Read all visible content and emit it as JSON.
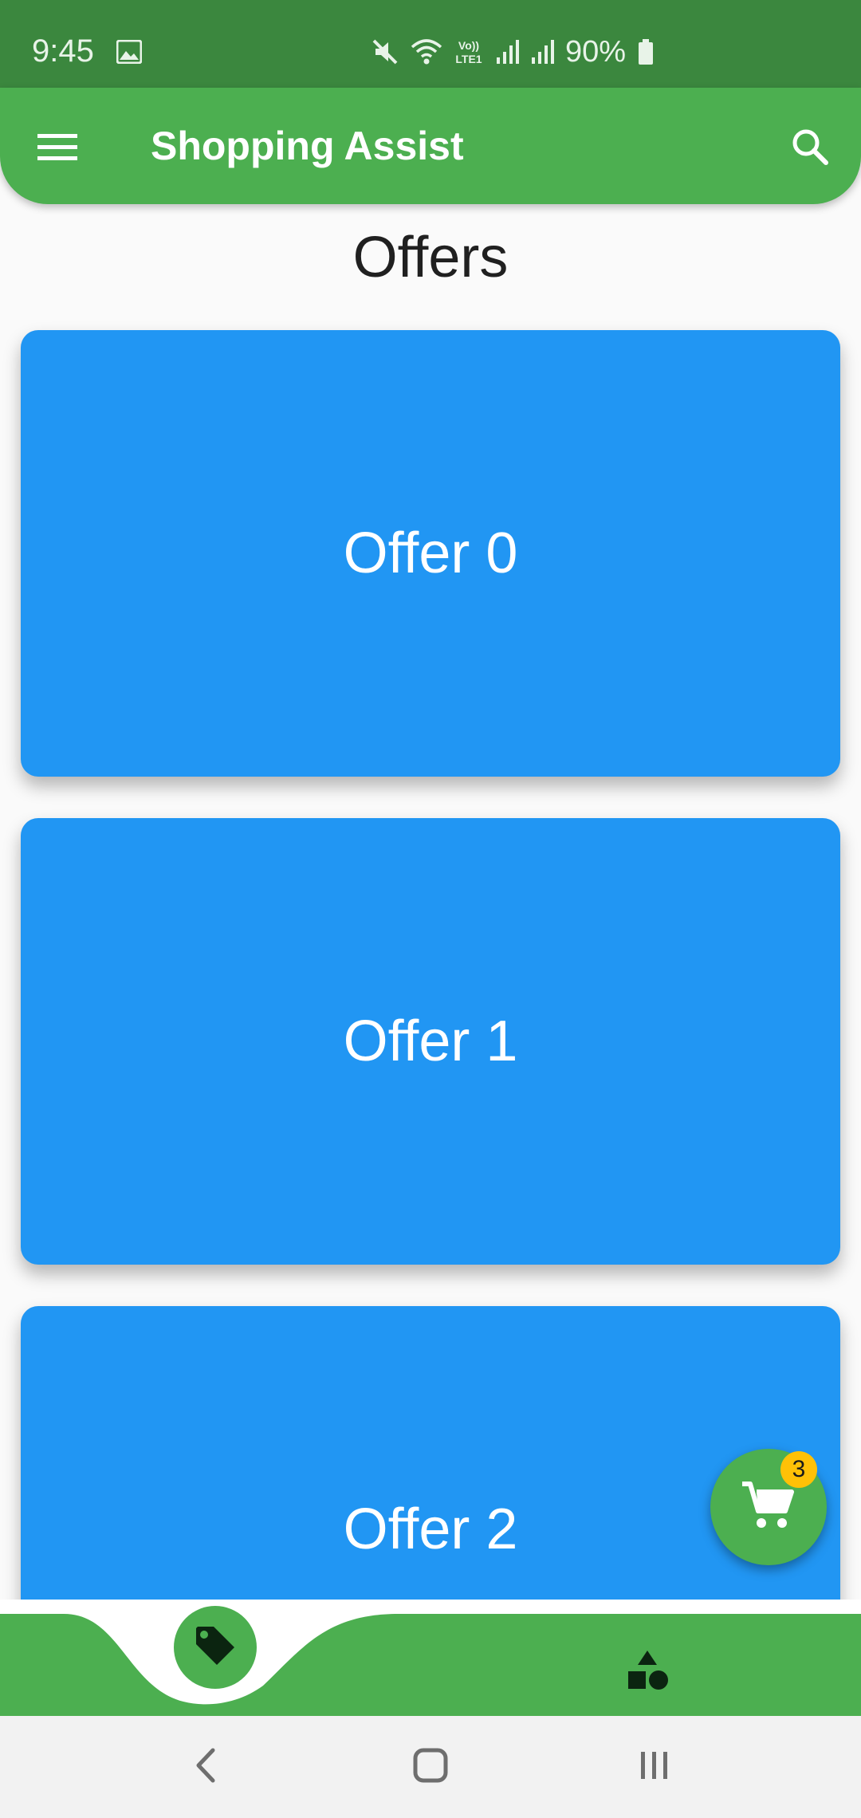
{
  "status_bar": {
    "time": "9:45",
    "battery_text": "90%",
    "icons": [
      "gallery-icon",
      "mute-icon",
      "wifi-icon",
      "volte-icon",
      "signal-icon",
      "signal-icon",
      "battery-icon"
    ],
    "volte_label": "Vo)) LTE1",
    "background_color": "#3b873e"
  },
  "app_bar": {
    "title": "Shopping Assist",
    "menu_icon": "menu-icon",
    "search_icon": "search-icon",
    "background_color": "#4caf50"
  },
  "page": {
    "title": "Offers"
  },
  "offers": [
    {
      "label": "Offer 0"
    },
    {
      "label": "Offer 1"
    },
    {
      "label": "Offer 2"
    }
  ],
  "offer_card_color": "#2196f3",
  "cart_fab": {
    "icon": "cart-icon",
    "badge_count": "3",
    "badge_color": "#ffc107"
  },
  "bottom_nav": {
    "items": [
      {
        "name": "offers",
        "icon": "tag-icon",
        "selected": true
      },
      {
        "name": "categories",
        "icon": "shapes-icon",
        "selected": false
      }
    ]
  },
  "system_nav": {
    "buttons": [
      "back-icon",
      "home-icon",
      "recents-icon"
    ]
  }
}
